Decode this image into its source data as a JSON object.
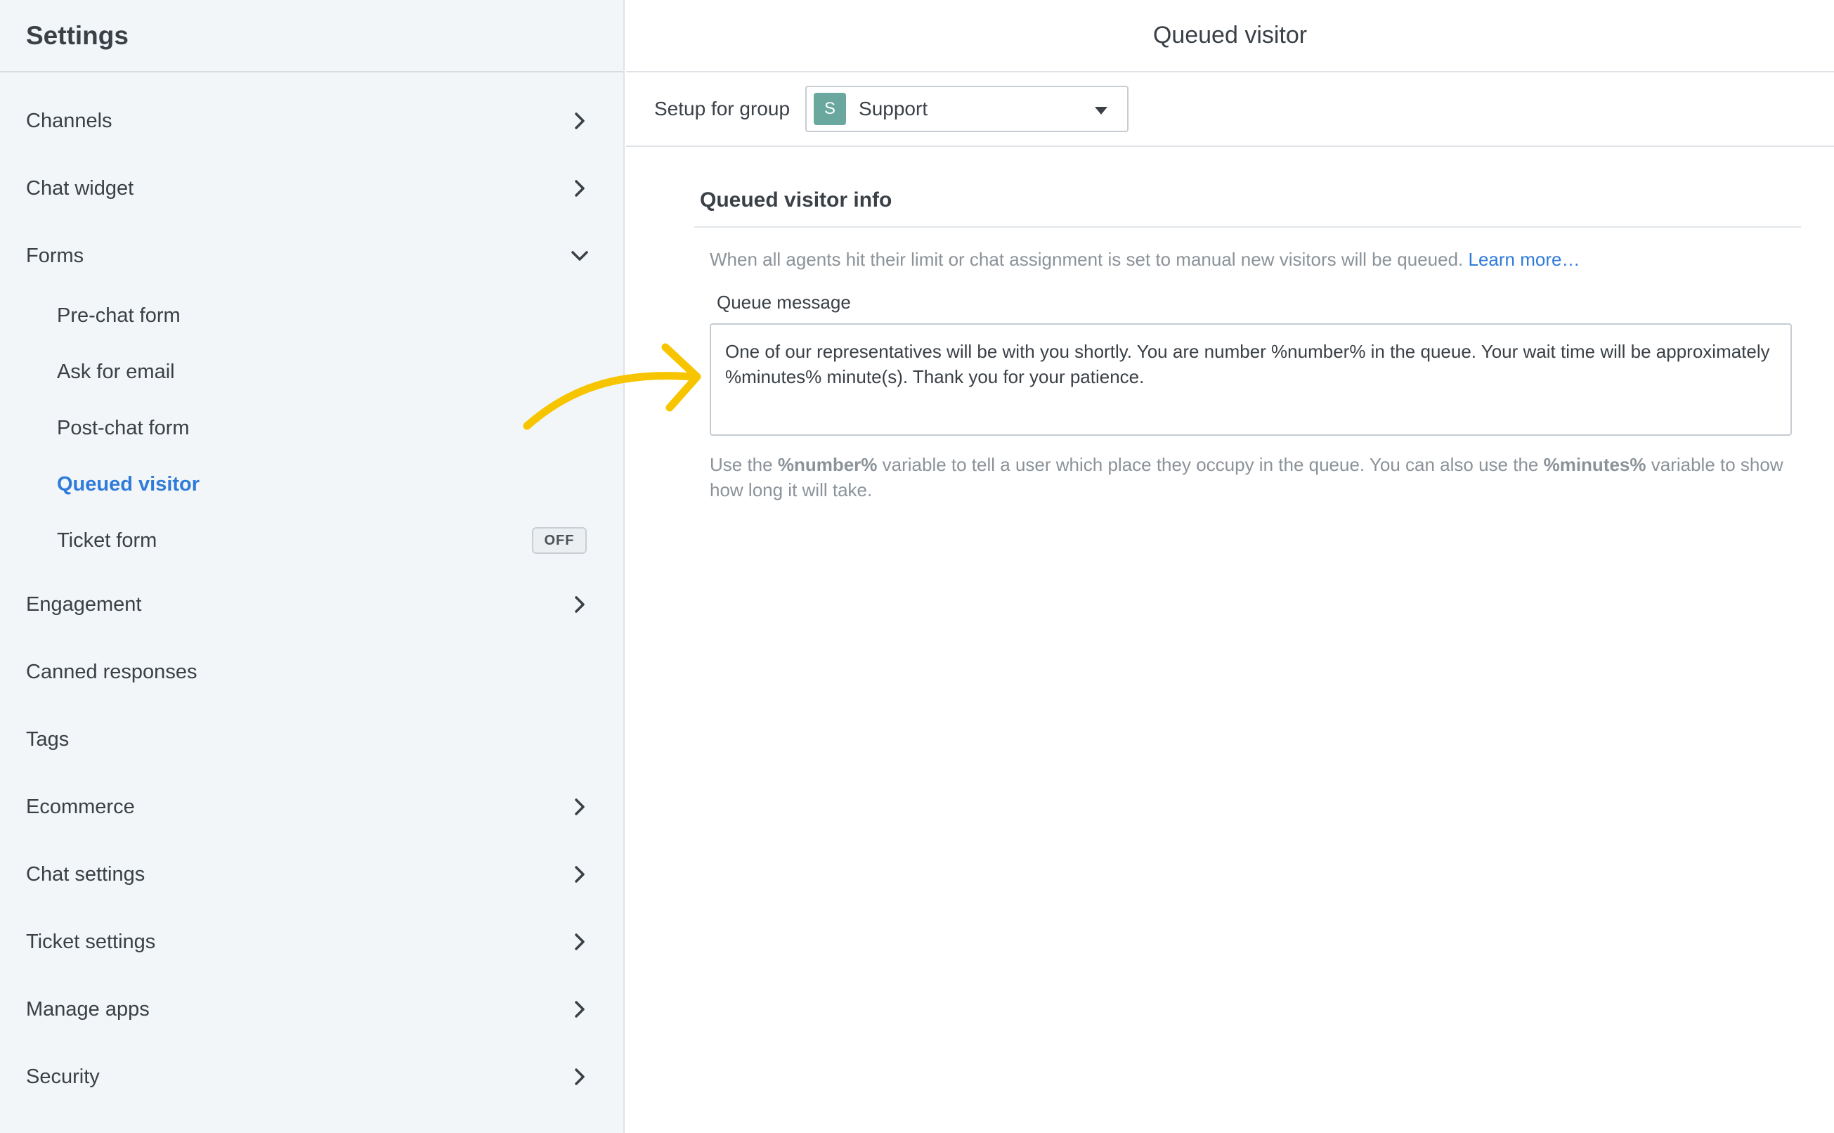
{
  "sidebar": {
    "title": "Settings",
    "items": [
      {
        "label": "Channels"
      },
      {
        "label": "Chat widget"
      },
      {
        "label": "Forms"
      },
      {
        "label": "Pre-chat form"
      },
      {
        "label": "Ask for email"
      },
      {
        "label": "Post-chat form"
      },
      {
        "label": "Queued visitor"
      },
      {
        "label": "Ticket form",
        "toggle": "OFF"
      },
      {
        "label": "Engagement"
      },
      {
        "label": "Canned responses"
      },
      {
        "label": "Tags"
      },
      {
        "label": "Ecommerce"
      },
      {
        "label": "Chat settings"
      },
      {
        "label": "Ticket settings"
      },
      {
        "label": "Manage apps"
      },
      {
        "label": "Security"
      }
    ]
  },
  "main": {
    "title": "Queued visitor",
    "group_label": "Setup for group",
    "group_avatar": "S",
    "group_value": "Support",
    "section_title": "Queued visitor info",
    "description": "When all agents hit their limit or chat assignment is set to manual new visitors will be queued. ",
    "learn_more": "Learn more…",
    "queue_label": "Queue message",
    "queue_message": "One of our representatives will be with you shortly. You are number %number% in the queue. Your wait time will be approximately %minutes% minute(s). Thank you for your patience.",
    "hint_1": "Use the ",
    "hint_var_1": "%number%",
    "hint_2": " variable to tell a user which place they occupy in the queue. You can also use the ",
    "hint_var_2": "%minutes%",
    "hint_3": " variable to show how long it will take."
  },
  "colors": {
    "accent": "#2f7bd9",
    "annotation_arrow": "#f7c500",
    "group_avatar": "#6aa89f"
  }
}
